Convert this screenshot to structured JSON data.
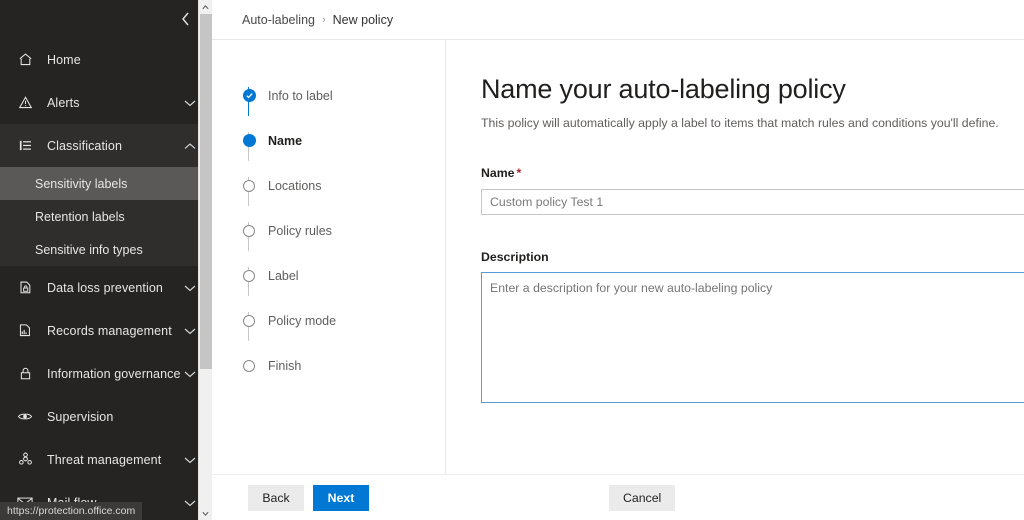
{
  "status_bar": {
    "url": "https://protection.office.com"
  },
  "sidebar": {
    "collapse_icon": "chevron-left-icon",
    "items": [
      {
        "label": "Home",
        "icon": "home-icon",
        "chevron": false,
        "expanded": false
      },
      {
        "label": "Alerts",
        "icon": "alert-triangle-icon",
        "chevron": true,
        "expanded": false
      },
      {
        "label": "Classification",
        "icon": "classification-list-icon",
        "chevron": true,
        "expanded": true
      },
      {
        "label": "Data loss prevention",
        "icon": "document-lock-icon",
        "chevron": true,
        "expanded": false
      },
      {
        "label": "Records management",
        "icon": "records-document-icon",
        "chevron": true,
        "expanded": false
      },
      {
        "label": "Information governance",
        "icon": "padlock-icon",
        "chevron": true,
        "expanded": false
      },
      {
        "label": "Supervision",
        "icon": "eye-icon",
        "chevron": false,
        "expanded": false
      },
      {
        "label": "Threat management",
        "icon": "biohazard-icon",
        "chevron": true,
        "expanded": false
      },
      {
        "label": "Mail flow",
        "icon": "envelope-icon",
        "chevron": true,
        "expanded": false
      }
    ],
    "sub_items": [
      {
        "label": "Sensitivity labels",
        "selected": true
      },
      {
        "label": "Retention labels",
        "selected": false
      },
      {
        "label": "Sensitive info types",
        "selected": false
      }
    ]
  },
  "breadcrumb": {
    "parent": "Auto-labeling",
    "separator": "›",
    "current": "New policy"
  },
  "wizard": {
    "steps": [
      {
        "label": "Info to label",
        "state": "done"
      },
      {
        "label": "Name",
        "state": "current"
      },
      {
        "label": "Locations",
        "state": "todo"
      },
      {
        "label": "Policy rules",
        "state": "todo"
      },
      {
        "label": "Label",
        "state": "todo"
      },
      {
        "label": "Policy mode",
        "state": "todo"
      },
      {
        "label": "Finish",
        "state": "todo"
      }
    ]
  },
  "main": {
    "title": "Name your auto-labeling policy",
    "subtitle": "This policy will automatically apply a label to items that match rules and conditions you'll define.",
    "name_field": {
      "label": "Name",
      "required_mark": "*",
      "value": "Custom policy Test 1"
    },
    "description_field": {
      "label": "Description",
      "placeholder": "Enter a description for your new auto-labeling policy",
      "value": ""
    }
  },
  "footer": {
    "back_label": "Back",
    "next_label": "Next",
    "cancel_label": "Cancel"
  },
  "colors": {
    "accent": "#0078d4",
    "sidebar_bg": "#252423",
    "sidebar_expanded": "#2f2e2d",
    "sidebar_selected": "#5a5958",
    "focus_border": "#5b9bd5",
    "required": "#a4262c"
  }
}
